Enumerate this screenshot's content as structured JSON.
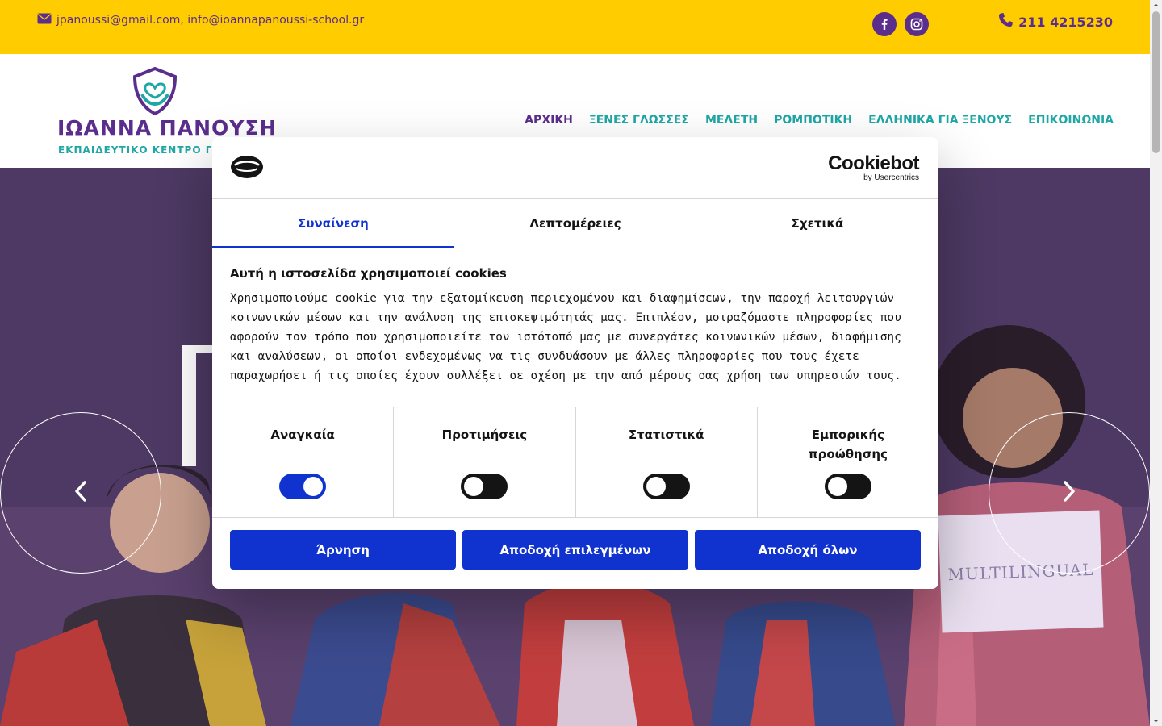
{
  "topbar": {
    "emails": "jpanoussi@gmail.com, info@ioannapanoussi-school.gr",
    "phone": "211 4215230",
    "social": [
      {
        "icon": "facebook-icon",
        "label": "f"
      },
      {
        "icon": "instagram-icon",
        "label": ""
      }
    ],
    "colors": {
      "background": "#ffcc00",
      "text": "#5b2d8c"
    }
  },
  "header": {
    "logo_name": "ΙΩΑΝΝΑ ΠΑΝΟΥΣΗ",
    "logo_subtitle": "ΕΚΠΑΙΔΕΥΤΙΚΟ ΚΕΝΤΡΟ ΓΛ",
    "nav": [
      {
        "label": "ΑΡΧΙΚΗ",
        "active": true
      },
      {
        "label": "ΞΕΝΕΣ ΓΛΩΣΣΕΣ",
        "active": false
      },
      {
        "label": "ΜΕΛΕΤΗ",
        "active": false
      },
      {
        "label": "ΡΟΜΠΟΤΙΚΗ",
        "active": false
      },
      {
        "label": "ΕΛΛΗΝΙΚΑ ΓΙΑ ΞΕΝΟΥΣ",
        "active": false
      },
      {
        "label": "ΕΠΙΚΟΙΝΩΝΙΑ",
        "active": false
      }
    ],
    "colors": {
      "active": "#5b2d8c",
      "link": "#1ea7a5"
    }
  },
  "hero": {
    "sign_text": "MULTILINGUAL",
    "prev_icon": "chevron-left-icon",
    "next_icon": "chevron-right-icon"
  },
  "cookie_dialog": {
    "brand": "Cookiebot",
    "brand_sub": "by Usercentrics",
    "tabs": [
      {
        "label": "Συναίνεση",
        "active": true
      },
      {
        "label": "Λεπτομέρειες",
        "active": false
      },
      {
        "label": "Σχετικά",
        "active": false
      }
    ],
    "title": "Αυτή η ιστοσελίδα χρησιμοποιεί cookies",
    "body": "Χρησιμοποιούμε cookie για την εξατομίκευση περιεχομένου και διαφημίσεων, την παροχή λειτουργιών κοινωνικών μέσων και την ανάλυση της επισκεψιμότητάς μας. Επιπλέον, μοιραζόμαστε πληροφορίες που αφορούν τον τρόπο που χρησιμοποιείτε τον ιστότοπό μας με συνεργάτες κοινωνικών μέσων, διαφήμισης και αναλύσεων, οι οποίοι ενδεχομένως να τις συνδυάσουν με άλλες πληροφορίες που τους έχετε παραχωρήσει ή τις οποίες έχουν συλλέξει σε σχέση με την από μέρους σας χρήση των υπηρεσιών τους.",
    "toggles": [
      {
        "label": "Αναγκαία",
        "on": true
      },
      {
        "label": "Προτιμήσεις",
        "on": false
      },
      {
        "label": "Στατιστικά",
        "on": false
      },
      {
        "label": "Εμπορικής προώθησης",
        "on": false
      }
    ],
    "buttons": {
      "deny": "Άρνηση",
      "accept_selected": "Αποδοχή επιλεγμένων",
      "accept_all": "Αποδοχή όλων"
    },
    "colors": {
      "accent": "#1032cf",
      "text": "#141414"
    }
  }
}
